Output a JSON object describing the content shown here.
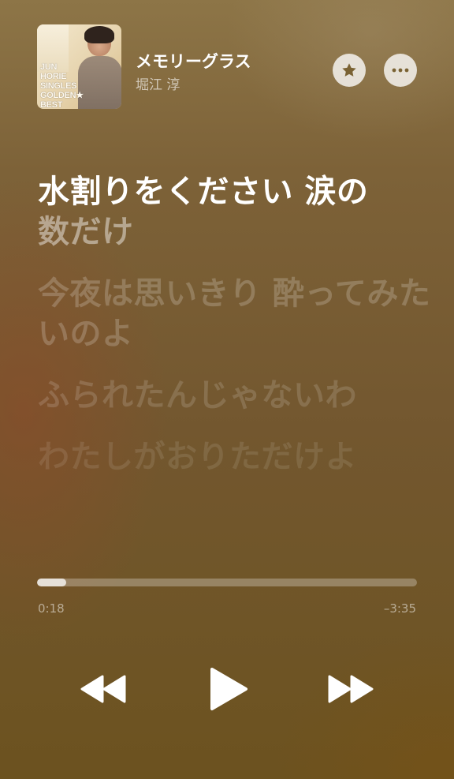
{
  "now_playing": {
    "title": "メモリーグラス",
    "artist": "堀江 淳",
    "album_art": {
      "text_lines": [
        "JUN",
        "HORIE",
        "SINGLES",
        "GOLDEN★",
        "BEST"
      ],
      "description_icon": "album-cover"
    }
  },
  "actions": {
    "favorite_icon": "star-icon",
    "more_icon": "ellipsis-icon"
  },
  "lyrics": {
    "active_line_main": "水割りをください 涙の",
    "active_line_tail": "数だけ",
    "upcoming_lines": [
      "今夜は思いきり 酔ってみたいのよ",
      "ふられたんじゃないわ",
      "わたしがおりただけよ"
    ]
  },
  "playback": {
    "elapsed": "0:18",
    "remaining": "–3:35",
    "progress_fraction": 0.077
  },
  "controls": {
    "previous_icon": "rewind-icon",
    "play_icon": "play-icon",
    "next_icon": "fast-forward-icon"
  },
  "colors": {
    "accent": "#ffffff",
    "background_top": "#8d7547",
    "background_bottom": "#6c521f"
  }
}
